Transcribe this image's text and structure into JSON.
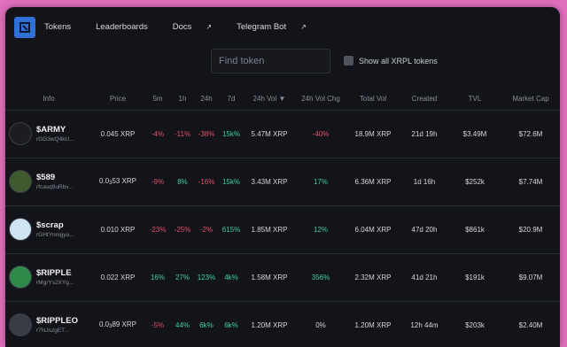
{
  "nav": {
    "links": [
      {
        "label": "Tokens",
        "external": ""
      },
      {
        "label": "Leaderboards",
        "external": ""
      },
      {
        "label": "Docs",
        "external": "↗"
      },
      {
        "label": "Telegram Bot",
        "external": "↗"
      }
    ]
  },
  "search": {
    "placeholder": "Find token"
  },
  "xrpl_toggle": {
    "label": "Show all XRPL tokens"
  },
  "table": {
    "headers": [
      "Info",
      "Price",
      "5m",
      "1h",
      "24h",
      "7d",
      "24h Vol ▼",
      "24h Vol Chg",
      "Total Vol",
      "Created",
      "TVL",
      "Market Cap"
    ],
    "rows": [
      {
        "name": "$ARMY",
        "address": "rGG3wQ4kU...",
        "price_main": "0.045 XRP",
        "price_prefix": "",
        "price_sub": "",
        "price_suffix": "",
        "m5": "-4%",
        "h1": "-11%",
        "h24": "-38%",
        "d7": "15k%",
        "vol24": "5.47M XRP",
        "volchg": "-40%",
        "totalvol": "18.9M XRP",
        "created": "21d 19h",
        "tvl": "$3.49M",
        "mcap": "$72.6M",
        "avatar_color": "#1c1d22"
      },
      {
        "name": "$589",
        "address": "rfcasq9uRbv...",
        "price_main": "",
        "price_prefix": "0.0",
        "price_sub": "3",
        "price_suffix": "53 XRP",
        "m5": "-9%",
        "h1": "8%",
        "h24": "-16%",
        "d7": "15k%",
        "vol24": "3.43M XRP",
        "volchg": "17%",
        "totalvol": "6.36M XRP",
        "created": "1d 16h",
        "tvl": "$252k",
        "mcap": "$7.74M",
        "avatar_color": "#3f5a2f"
      },
      {
        "name": "$scrap",
        "address": "rGHtYnnigyu...",
        "price_main": "0.010 XRP",
        "price_prefix": "",
        "price_sub": "",
        "price_suffix": "",
        "m5": "-23%",
        "h1": "-25%",
        "h24": "-2%",
        "d7": "615%",
        "vol24": "1.85M XRP",
        "volchg": "12%",
        "totalvol": "6.04M XRP",
        "created": "47d 20h",
        "tvl": "$861k",
        "mcap": "$20.9M",
        "avatar_color": "#cfe4f2"
      },
      {
        "name": "$RIPPLE",
        "address": "rMgrYs2XYg...",
        "price_main": "0.022 XRP",
        "price_prefix": "",
        "price_sub": "",
        "price_suffix": "",
        "m5": "16%",
        "h1": "27%",
        "h24": "123%",
        "d7": "4k%",
        "vol24": "1.58M XRP",
        "volchg": "356%",
        "totalvol": "2.32M XRP",
        "created": "41d 21h",
        "tvl": "$191k",
        "mcap": "$9.07M",
        "avatar_color": "#2f8a4a"
      },
      {
        "name": "$RIPPLEO",
        "address": "r7NJszgET...",
        "price_main": "",
        "price_prefix": "0.0",
        "price_sub": "3",
        "price_suffix": "89 XRP",
        "m5": "-5%",
        "h1": "44%",
        "h24": "6k%",
        "d7": "6k%",
        "vol24": "1.20M XRP",
        "volchg": "0%",
        "totalvol": "1.20M XRP",
        "created": "12h 44m",
        "tvl": "$203k",
        "mcap": "$2.40M",
        "avatar_color": "#3a3c45"
      }
    ]
  },
  "colors": {
    "positive": "#3fcf9a",
    "negative": "#e0506a",
    "brand": "#2f6fd6"
  }
}
